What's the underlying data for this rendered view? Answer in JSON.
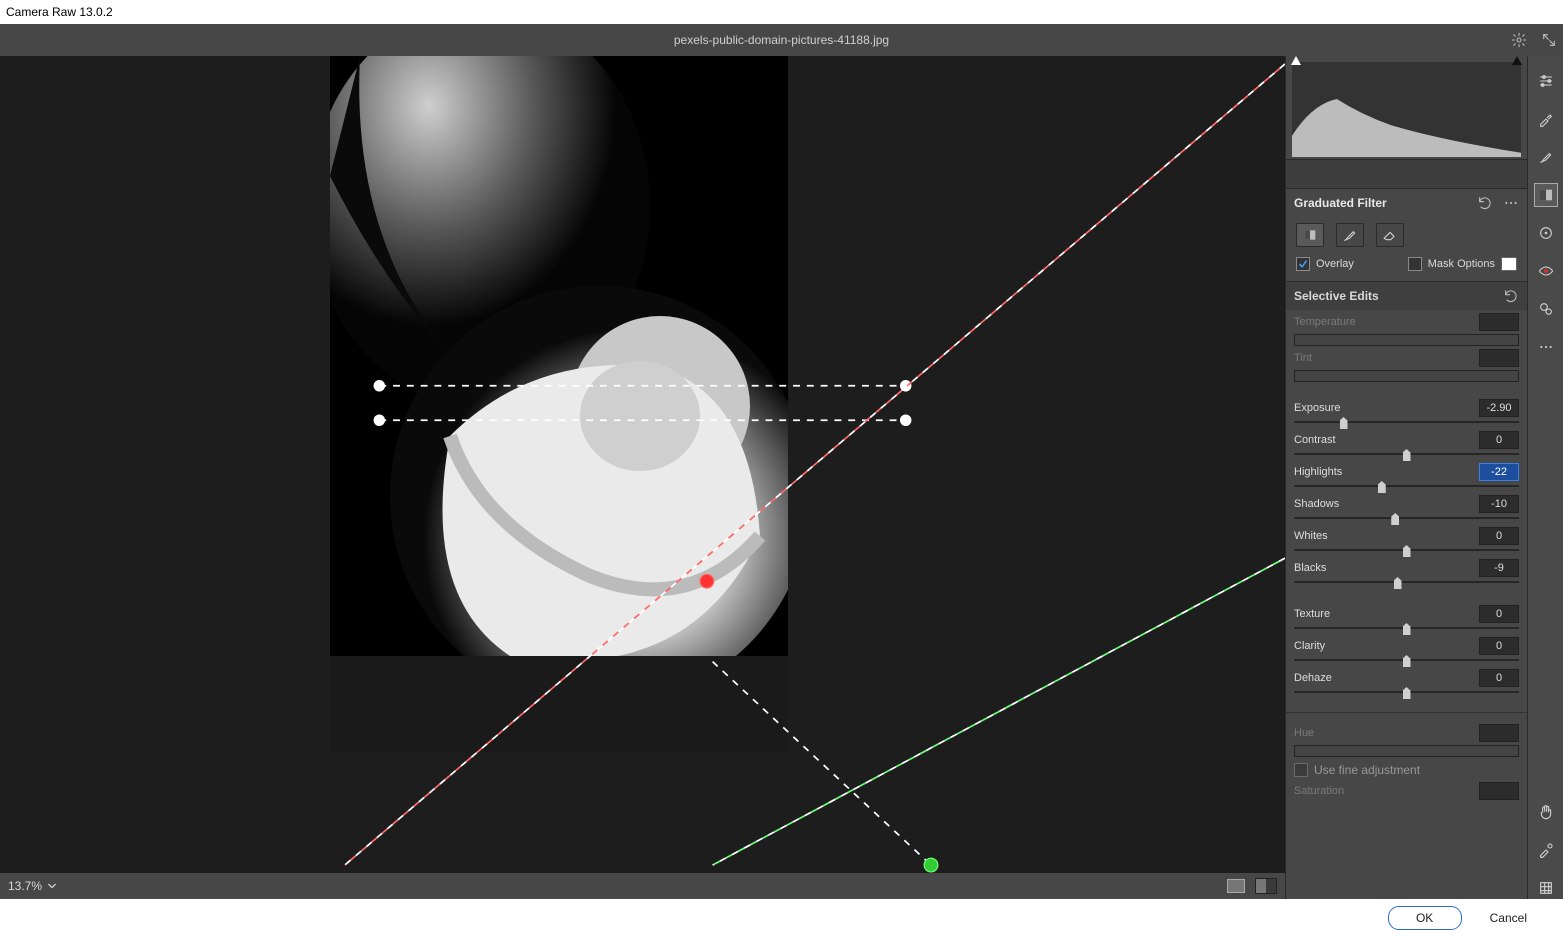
{
  "app": {
    "title": "Camera Raw 13.0.2"
  },
  "topbar": {
    "filename": "pexels-public-domain-pictures-41188.jpg"
  },
  "status": {
    "zoom": "13.7%"
  },
  "panel": {
    "title": "Graduated Filter",
    "overlay_label": "Overlay",
    "overlay_checked": true,
    "mask_label": "Mask Options",
    "mask_checked": false
  },
  "selective": {
    "title": "Selective Edits"
  },
  "sliders": {
    "temperature": {
      "label": "Temperature",
      "value": "",
      "disabled": true
    },
    "tint": {
      "label": "Tint",
      "value": "",
      "disabled": true
    },
    "exposure": {
      "label": "Exposure",
      "value": "-2.90",
      "pos": 22
    },
    "contrast": {
      "label": "Contrast",
      "value": "0",
      "pos": 50
    },
    "highlights": {
      "label": "Highlights",
      "value": "-22",
      "pos": 39,
      "active": true
    },
    "shadows": {
      "label": "Shadows",
      "value": "-10",
      "pos": 45
    },
    "whites": {
      "label": "Whites",
      "value": "0",
      "pos": 50
    },
    "blacks": {
      "label": "Blacks",
      "value": "-9",
      "pos": 46
    },
    "texture": {
      "label": "Texture",
      "value": "0",
      "pos": 50
    },
    "clarity": {
      "label": "Clarity",
      "value": "0",
      "pos": 50
    },
    "dehaze": {
      "label": "Dehaze",
      "value": "0",
      "pos": 50
    },
    "hue": {
      "label": "Hue",
      "value": "",
      "disabled": true
    },
    "fineadj": {
      "label": "Use fine adjustment",
      "checked": false,
      "disabled": true
    },
    "saturation": {
      "label": "Saturation",
      "value": "",
      "disabled": true
    }
  },
  "footer": {
    "ok": "OK",
    "cancel": "Cancel"
  }
}
